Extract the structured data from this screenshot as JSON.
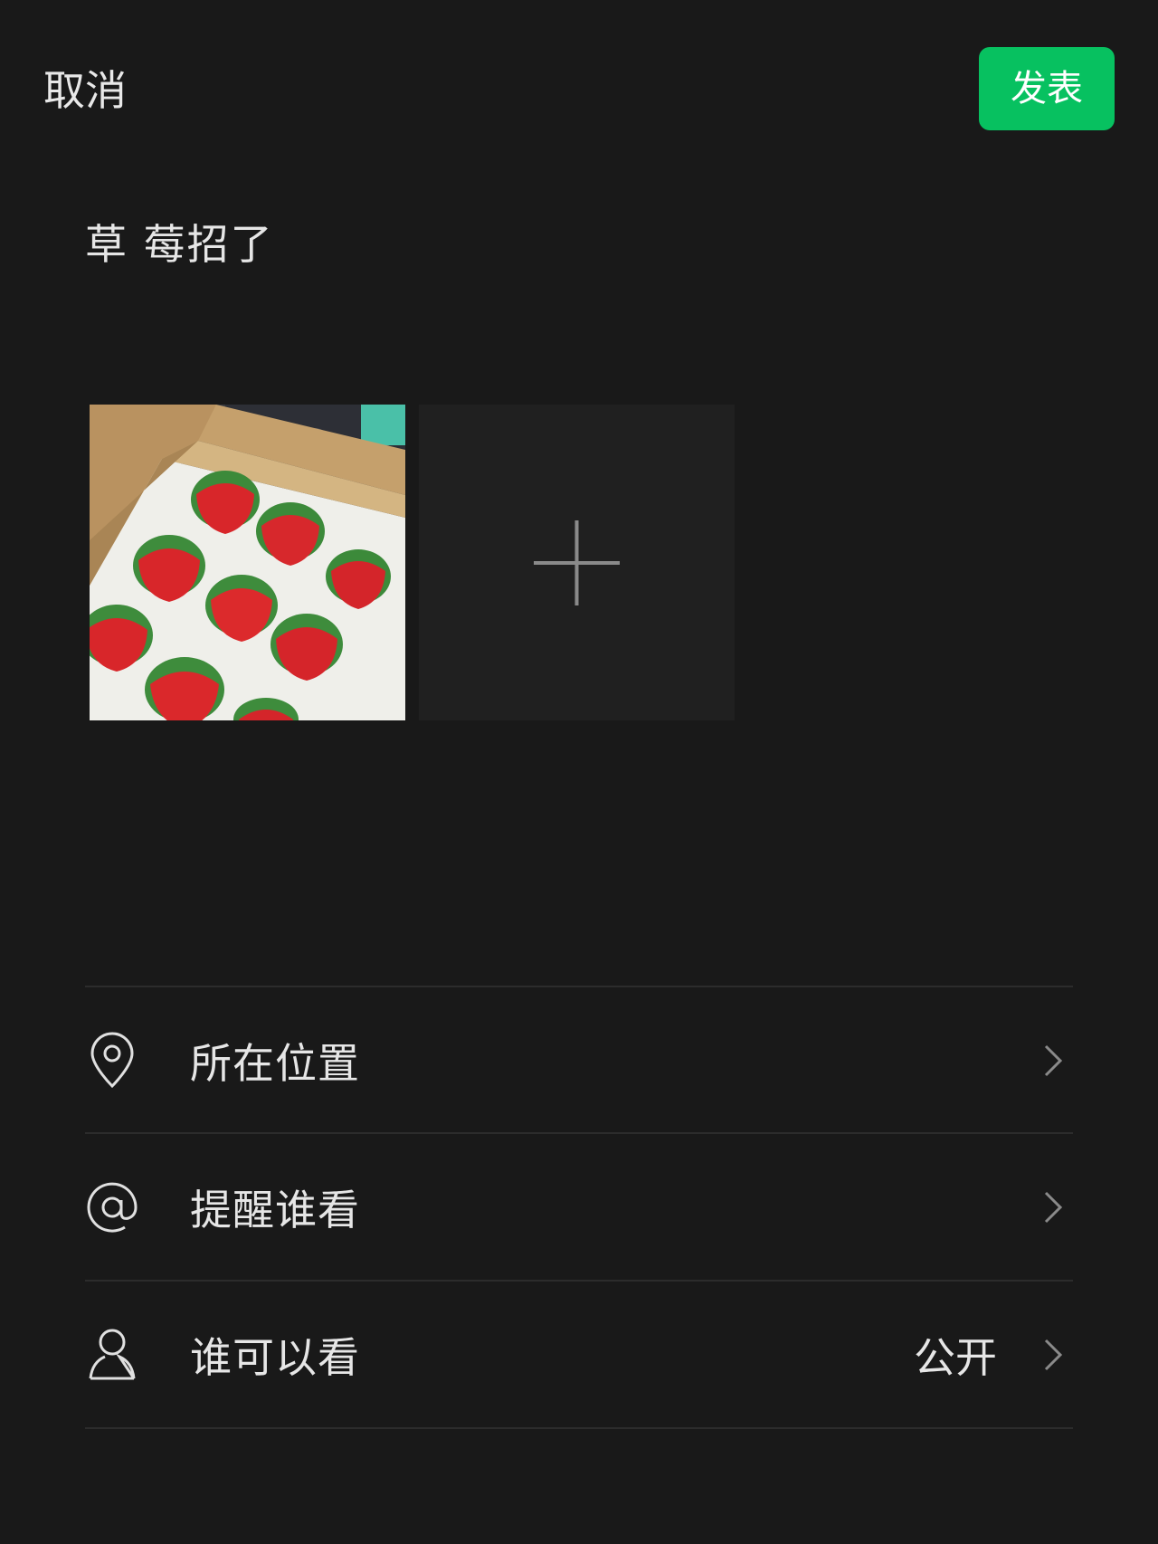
{
  "header": {
    "cancel_label": "取消",
    "publish_label": "发表",
    "publish_color": "#07c160"
  },
  "composer": {
    "text": "草 莓招了"
  },
  "media": {
    "photos": [
      {
        "icon": "strawberry-box-photo"
      }
    ],
    "add_icon": "plus-icon"
  },
  "options": [
    {
      "icon": "location-pin-icon",
      "label": "所在位置",
      "value": ""
    },
    {
      "icon": "at-sign-icon",
      "label": "提醒谁看",
      "value": ""
    },
    {
      "icon": "person-icon",
      "label": "谁可以看",
      "value": "公开"
    }
  ]
}
